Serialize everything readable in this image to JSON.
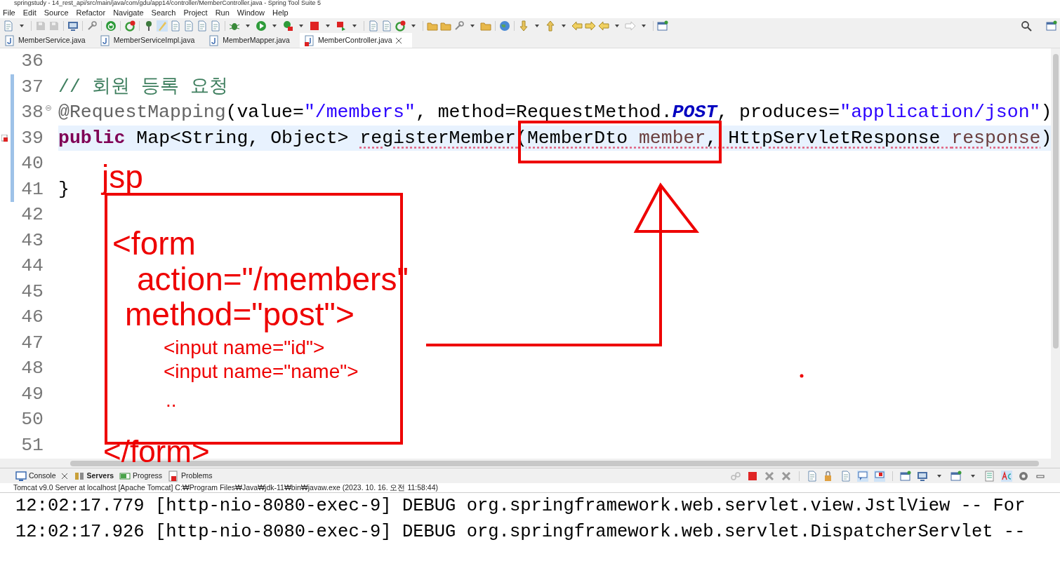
{
  "window": {
    "title": "springstudy - 14_rest_api/src/main/java/com/gdu/app14/controller/MemberController.java - Spring Tool Suite 5"
  },
  "menu": [
    "File",
    "Edit",
    "Source",
    "Refactor",
    "Navigate",
    "Search",
    "Project",
    "Run",
    "Window",
    "Help"
  ],
  "editor_tabs": [
    {
      "label": "MemberService.java",
      "selected": false
    },
    {
      "label": "MemberServiceImpl.java",
      "selected": false
    },
    {
      "label": "MemberMapper.java",
      "selected": false
    },
    {
      "label": "MemberController.java",
      "selected": true
    }
  ],
  "code_lines": [
    {
      "number": "36",
      "current": false
    },
    {
      "number": "37",
      "current": false,
      "tokens": [
        {
          "text": "// 회원 등록 요청",
          "kind": "comment"
        }
      ]
    },
    {
      "number": "38",
      "current": false,
      "fold": true,
      "tokens": [
        {
          "text": "@RequestMapping",
          "kind": "annotation"
        },
        {
          "text": "(value=",
          "kind": "plain"
        },
        {
          "text": "\"/members\"",
          "kind": "string"
        },
        {
          "text": ", method=RequestMethod.",
          "kind": "plain"
        },
        {
          "text": "POST",
          "kind": "constant"
        },
        {
          "text": ", produces=",
          "kind": "plain"
        },
        {
          "text": "\"application/json\"",
          "kind": "string"
        },
        {
          "text": ")",
          "kind": "plain"
        }
      ]
    },
    {
      "number": "39",
      "current": true,
      "error_marker": true,
      "tokens": [
        {
          "text": "public",
          "kind": "keyword"
        },
        {
          "text": " Map<String, Object> ",
          "kind": "plain"
        },
        {
          "text": "registerMember",
          "kind": "plain",
          "underlined": true
        },
        {
          "text": "(MemberDto ",
          "kind": "plain",
          "underlined": true
        },
        {
          "text": "member",
          "kind": "param",
          "underlined": true
        },
        {
          "text": ", HttpServletResponse ",
          "kind": "plain",
          "underlined": true
        },
        {
          "text": "response",
          "kind": "param",
          "underlined": true
        },
        {
          "text": ")",
          "kind": "plain"
        }
      ]
    },
    {
      "number": "40",
      "current": false
    },
    {
      "number": "41",
      "current": false,
      "tokens": [
        {
          "text": "}",
          "kind": "plain"
        }
      ]
    },
    {
      "number": "42",
      "current": false
    },
    {
      "number": "43",
      "current": false
    },
    {
      "number": "44",
      "current": false
    },
    {
      "number": "45",
      "current": false
    },
    {
      "number": "46",
      "current": false
    },
    {
      "number": "47",
      "current": false
    },
    {
      "number": "48",
      "current": false
    },
    {
      "number": "49",
      "current": false
    },
    {
      "number": "50",
      "current": false
    },
    {
      "number": "51",
      "current": false
    }
  ],
  "annotations": [
    {
      "text": "jsp"
    },
    {
      "text": "<form"
    },
    {
      "text": "action=\"/members\""
    },
    {
      "text": "method=\"post\">"
    },
    {
      "text": "<input name=\"id\">"
    },
    {
      "text": "<input name=\"name\">"
    },
    {
      "text": ".."
    },
    {
      "text": "</form>"
    }
  ],
  "console": {
    "tabs": [
      {
        "label": "Console",
        "selected": true,
        "emphasized": false
      },
      {
        "label": "Servers",
        "selected": false,
        "emphasized": true
      },
      {
        "label": "Progress",
        "selected": false,
        "emphasized": false
      },
      {
        "label": "Problems",
        "selected": false,
        "emphasized": false
      }
    ],
    "status": "Tomcat v9.0 Server at localhost [Apache Tomcat] C:₩Program Files₩Java₩jdk-11₩bin₩javaw.exe  (2023. 10. 16. 오전 11:58:44)",
    "lines": [
      "12:02:17.779 [http-nio-8080-exec-9] DEBUG org.springframework.web.servlet.view.JstlView -- For",
      "12:02:17.926 [http-nio-8080-exec-9] DEBUG org.springframework.web.servlet.DispatcherServlet --"
    ]
  }
}
